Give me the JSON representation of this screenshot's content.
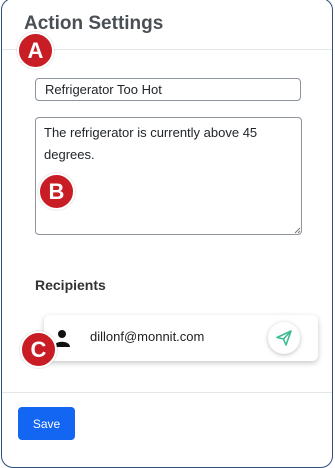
{
  "header": {
    "title": "Action Settings"
  },
  "form": {
    "subject_value": "Refrigerator Too Hot",
    "message_value": "The refrigerator is currently above 45 degrees."
  },
  "recipients": {
    "label": "Recipients",
    "items": [
      {
        "email": "dillonf@monnit.com",
        "icon": "person-icon",
        "action_icon": "send-icon"
      }
    ]
  },
  "footer": {
    "save_label": "Save"
  },
  "markers": {
    "a": "A",
    "b": "B",
    "c": "C"
  },
  "colors": {
    "accent": "#1266f1",
    "marker": "#c81d25",
    "panel_border": "#2d4f7c",
    "send_icon": "#3dbd8f"
  }
}
